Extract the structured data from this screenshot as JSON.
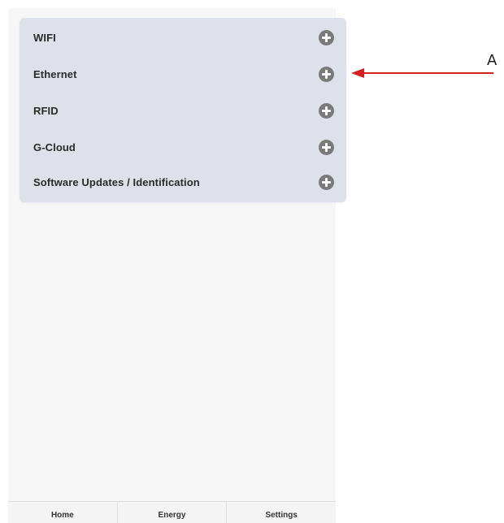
{
  "settings": {
    "items": [
      {
        "label": "WIFI",
        "icon": "plus-circle-icon"
      },
      {
        "label": "Ethernet",
        "icon": "plus-circle-icon"
      },
      {
        "label": "RFID",
        "icon": "plus-circle-icon"
      },
      {
        "label": "G-Cloud",
        "icon": "plus-circle-icon"
      },
      {
        "label": "Software Updates / Identification",
        "icon": "plus-circle-icon"
      }
    ]
  },
  "bottom_nav": {
    "tabs": [
      {
        "label": "Home"
      },
      {
        "label": "Energy"
      },
      {
        "label": "Settings"
      }
    ]
  },
  "annotation": {
    "label": "A",
    "color": "#d62020"
  },
  "colors": {
    "panel_background": "#dfe1ea",
    "icon": "#7a7a7a",
    "page_background": "#f6f6f6"
  }
}
